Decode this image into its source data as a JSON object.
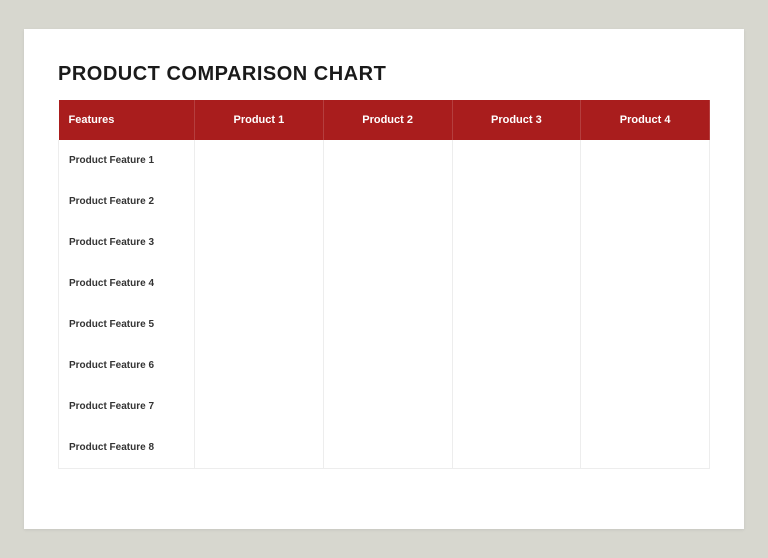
{
  "title": "PRODUCT COMPARISON CHART",
  "columns": [
    "Features",
    "Product 1",
    "Product 2",
    "Product 3",
    "Product 4"
  ],
  "rows": [
    {
      "feature": "Product Feature 1",
      "values": [
        "",
        "",
        "",
        ""
      ]
    },
    {
      "feature": "Product Feature 2",
      "values": [
        "",
        "",
        "",
        ""
      ]
    },
    {
      "feature": "Product Feature 3",
      "values": [
        "",
        "",
        "",
        ""
      ]
    },
    {
      "feature": "Product Feature 4",
      "values": [
        "",
        "",
        "",
        ""
      ]
    },
    {
      "feature": "Product Feature 5",
      "values": [
        "",
        "",
        "",
        ""
      ]
    },
    {
      "feature": "Product Feature 6",
      "values": [
        "",
        "",
        "",
        ""
      ]
    },
    {
      "feature": "Product Feature 7",
      "values": [
        "",
        "",
        "",
        ""
      ]
    },
    {
      "feature": "Product Feature 8",
      "values": [
        "",
        "",
        "",
        ""
      ]
    }
  ]
}
